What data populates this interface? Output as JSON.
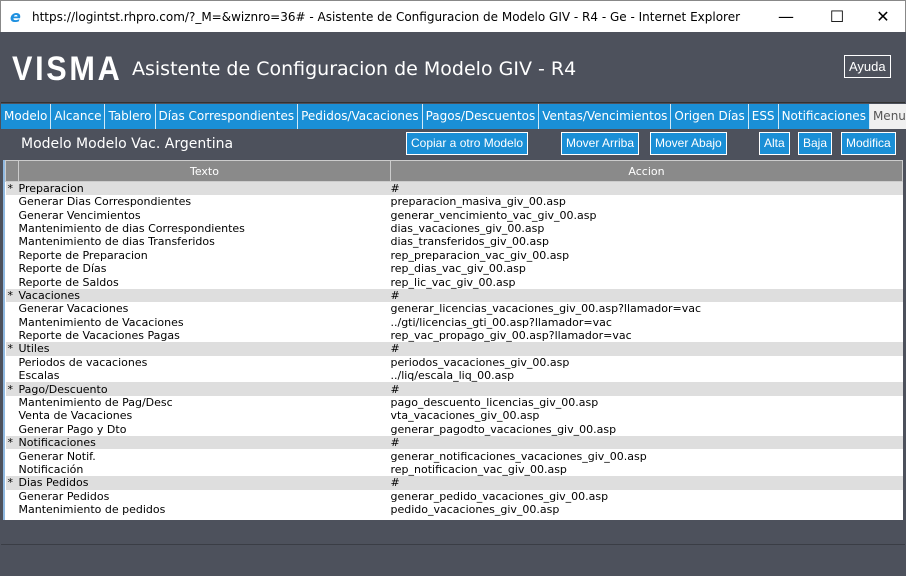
{
  "window": {
    "title": "https://logintst.rhpro.com/?_M=&wiznro=36# - Asistente de Configuracion de Modelo GIV - R4 - Ge - Internet Explorer",
    "minimize": "—",
    "maximize": "☐",
    "close": "✕"
  },
  "header": {
    "logo": "VISMA",
    "title": "Asistente de Configuracion de Modelo GIV - R4",
    "help": "Ayuda"
  },
  "tabs": [
    "Modelo",
    "Alcance",
    "Tablero",
    "Días Correspondientes",
    "Pedidos/Vacaciones",
    "Pagos/Descuentos",
    "Ventas/Vencimientos",
    "Origen Días",
    "ESS",
    "Notificaciones",
    "Menu"
  ],
  "active_tab": "Menu",
  "toolbar": {
    "model": "Modelo Modelo Vac. Argentina",
    "copy": "Copiar a otro Modelo",
    "up": "Mover Arriba",
    "down": "Mover Abajo",
    "add": "Alta",
    "del": "Baja",
    "edit": "Modifica"
  },
  "table": {
    "headers": [
      "Texto",
      "Accion"
    ],
    "rows": [
      {
        "g": "*",
        "t": "Preparacion",
        "a": "#"
      },
      {
        "g": "",
        "t": "Generar Dias Correspondientes",
        "a": "preparacion_masiva_giv_00.asp"
      },
      {
        "g": "",
        "t": "Generar Vencimientos",
        "a": "generar_vencimiento_vac_giv_00.asp"
      },
      {
        "g": "",
        "t": "Mantenimiento de dias Correspondientes",
        "a": "dias_vacaciones_giv_00.asp"
      },
      {
        "g": "",
        "t": "Mantenimiento de dias Transferidos",
        "a": "dias_transferidos_giv_00.asp"
      },
      {
        "g": "",
        "t": "Reporte de Preparacion",
        "a": "rep_preparacion_vac_giv_00.asp"
      },
      {
        "g": "",
        "t": "Reporte de Días",
        "a": "rep_dias_vac_giv_00.asp"
      },
      {
        "g": "",
        "t": "Reporte de Saldos",
        "a": "rep_lic_vac_giv_00.asp"
      },
      {
        "g": "*",
        "t": "Vacaciones",
        "a": "#"
      },
      {
        "g": "",
        "t": "Generar Vacaciones",
        "a": "generar_licencias_vacaciones_giv_00.asp?llamador=vac"
      },
      {
        "g": "",
        "t": "Mantenimiento de Vacaciones",
        "a": "../gti/licencias_gti_00.asp?llamador=vac"
      },
      {
        "g": "",
        "t": "Reporte de Vacaciones Pagas",
        "a": "rep_vac_propago_giv_00.asp?llamador=vac"
      },
      {
        "g": "*",
        "t": "Utiles",
        "a": "#"
      },
      {
        "g": "",
        "t": "Periodos de vacaciones",
        "a": "periodos_vacaciones_giv_00.asp"
      },
      {
        "g": "",
        "t": "Escalas",
        "a": "../liq/escala_liq_00.asp"
      },
      {
        "g": "*",
        "t": "Pago/Descuento",
        "a": "#"
      },
      {
        "g": "",
        "t": "Mantenimiento de Pag/Desc",
        "a": "pago_descuento_licencias_giv_00.asp"
      },
      {
        "g": "",
        "t": "Venta de Vacaciones",
        "a": "vta_vacaciones_giv_00.asp"
      },
      {
        "g": "",
        "t": "Generar Pago y Dto",
        "a": "generar_pagodto_vacaciones_giv_00.asp"
      },
      {
        "g": "*",
        "t": "Notificaciones",
        "a": "#"
      },
      {
        "g": "",
        "t": "Generar Notif.",
        "a": "generar_notificaciones_vacaciones_giv_00.asp"
      },
      {
        "g": "",
        "t": "Notificación",
        "a": "rep_notificacion_vac_giv_00.asp"
      },
      {
        "g": "*",
        "t": "Dias Pedidos",
        "a": "#"
      },
      {
        "g": "",
        "t": "Generar Pedidos",
        "a": "generar_pedido_vacaciones_giv_00.asp"
      },
      {
        "g": "",
        "t": "Mantenimiento de pedidos",
        "a": "pedido_vacaciones_giv_00.asp"
      }
    ]
  },
  "colors": {
    "header_bg": "#4d515c",
    "tab_blue": "#1a8fd6",
    "group_row": "#dedede"
  }
}
